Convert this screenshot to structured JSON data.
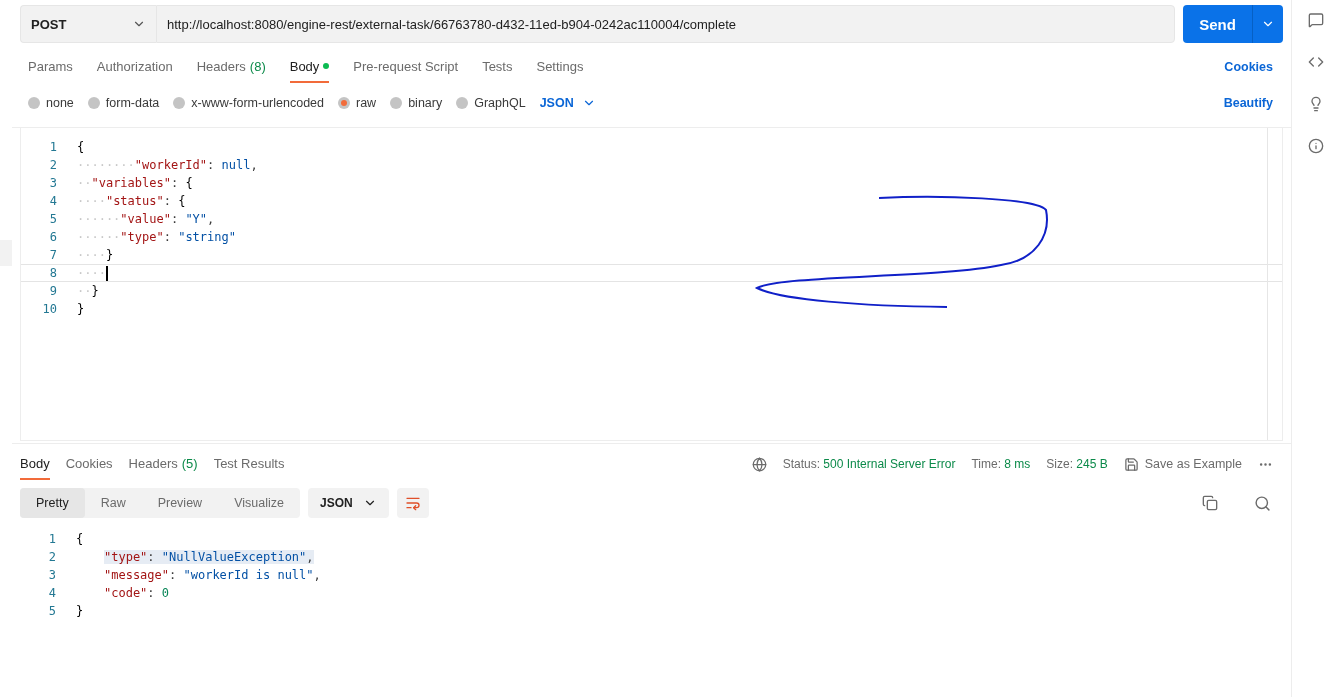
{
  "request": {
    "method": "POST",
    "url": "http://localhost:8080/engine-rest/external-task/66763780-d432-11ed-b904-0242ac110004/complete",
    "send_label": "Send"
  },
  "request_tabs": [
    {
      "label": "Params",
      "selected": false
    },
    {
      "label": "Authorization",
      "selected": false
    },
    {
      "label": "Headers",
      "count": "(8)",
      "selected": false
    },
    {
      "label": "Body",
      "selected": true,
      "dot": true
    },
    {
      "label": "Pre-request Script",
      "selected": false
    },
    {
      "label": "Tests",
      "selected": false
    },
    {
      "label": "Settings",
      "selected": false
    }
  ],
  "cookies_link": "Cookies",
  "body_types": [
    {
      "label": "none",
      "selected": false
    },
    {
      "label": "form-data",
      "selected": false
    },
    {
      "label": "x-www-form-urlencoded",
      "selected": false
    },
    {
      "label": "raw",
      "selected": true
    },
    {
      "label": "binary",
      "selected": false
    },
    {
      "label": "GraphQL",
      "selected": false
    }
  ],
  "body_format": "JSON",
  "beautify_link": "Beautify",
  "request_body": [
    {
      "number": "1",
      "current": false,
      "tokens": [
        {
          "kind": "brace",
          "text": "{"
        }
      ]
    },
    {
      "number": "2",
      "current": false,
      "tokens": [
        {
          "kind": "space",
          "text": "········"
        },
        {
          "kind": "key",
          "text": "\"workerId\""
        },
        {
          "kind": "punct",
          "text": ": "
        },
        {
          "kind": "keyword",
          "text": "null"
        },
        {
          "kind": "punct",
          "text": ","
        }
      ]
    },
    {
      "number": "3",
      "current": false,
      "tokens": [
        {
          "kind": "space",
          "text": "··"
        },
        {
          "kind": "key",
          "text": "\"variables\""
        },
        {
          "kind": "punct",
          "text": ": "
        },
        {
          "kind": "brace",
          "text": "{"
        }
      ]
    },
    {
      "number": "4",
      "current": false,
      "tokens": [
        {
          "kind": "space",
          "text": "····"
        },
        {
          "kind": "key",
          "text": "\"status\""
        },
        {
          "kind": "punct",
          "text": ": "
        },
        {
          "kind": "brace",
          "text": "{"
        }
      ]
    },
    {
      "number": "5",
      "current": false,
      "tokens": [
        {
          "kind": "space",
          "text": "······"
        },
        {
          "kind": "key",
          "text": "\"value\""
        },
        {
          "kind": "punct",
          "text": ": "
        },
        {
          "kind": "string",
          "text": "\"Y\""
        },
        {
          "kind": "punct",
          "text": ","
        }
      ]
    },
    {
      "number": "6",
      "current": false,
      "tokens": [
        {
          "kind": "space",
          "text": "······"
        },
        {
          "kind": "key",
          "text": "\"type\""
        },
        {
          "kind": "punct",
          "text": ": "
        },
        {
          "kind": "string",
          "text": "\"string\""
        }
      ]
    },
    {
      "number": "7",
      "current": false,
      "tokens": [
        {
          "kind": "space",
          "text": "····"
        },
        {
          "kind": "brace",
          "text": "}"
        }
      ]
    },
    {
      "number": "8",
      "current": true,
      "tokens": [
        {
          "kind": "space",
          "text": "····"
        }
      ]
    },
    {
      "number": "9",
      "current": false,
      "tokens": [
        {
          "kind": "space",
          "text": "··"
        },
        {
          "kind": "brace",
          "text": "}"
        }
      ]
    },
    {
      "number": "10",
      "current": false,
      "tokens": [
        {
          "kind": "brace",
          "text": "}"
        }
      ]
    }
  ],
  "response_tabs": [
    {
      "label": "Body",
      "selected": true
    },
    {
      "label": "Cookies",
      "selected": false
    },
    {
      "label": "Headers",
      "count": "(5)",
      "selected": false
    },
    {
      "label": "Test Results",
      "selected": false
    }
  ],
  "response_status": [
    {
      "label": "Status:",
      "value": "500 Internal Server Error"
    },
    {
      "label": "Time:",
      "value": "8 ms"
    },
    {
      "label": "Size:",
      "value": "245 B"
    }
  ],
  "save_example": "Save as Example",
  "view_modes": [
    {
      "label": "Pretty",
      "selected": true
    },
    {
      "label": "Raw",
      "selected": false
    },
    {
      "label": "Preview",
      "selected": false
    },
    {
      "label": "Visualize",
      "selected": false
    }
  ],
  "response_format": "JSON",
  "response_body": [
    {
      "number": "1",
      "highlighted": false,
      "tokens": [
        {
          "kind": "brace",
          "text": "{"
        }
      ],
      "children": [
        {
          "number": "2",
          "highlighted": true,
          "tokens": [
            {
              "kind": "key",
              "text": "\"type\""
            },
            {
              "kind": "punct",
              "text": ": "
            },
            {
              "kind": "string",
              "text": "\"NullValueException\""
            },
            {
              "kind": "punct",
              "text": ","
            }
          ]
        },
        {
          "number": "3",
          "highlighted": false,
          "tokens": [
            {
              "kind": "key",
              "text": "\"message\""
            },
            {
              "kind": "punct",
              "text": ": "
            },
            {
              "kind": "string",
              "text": "\"workerId is null\""
            },
            {
              "kind": "punct",
              "text": ","
            }
          ]
        },
        {
          "number": "4",
          "highlighted": false,
          "tokens": [
            {
              "kind": "key",
              "text": "\"code\""
            },
            {
              "kind": "punct",
              "text": ": "
            },
            {
              "kind": "number",
              "text": "0"
            }
          ]
        }
      ]
    },
    {
      "number": "5",
      "highlighted": false,
      "tokens": [
        {
          "kind": "brace",
          "text": "}"
        }
      ]
    }
  ]
}
